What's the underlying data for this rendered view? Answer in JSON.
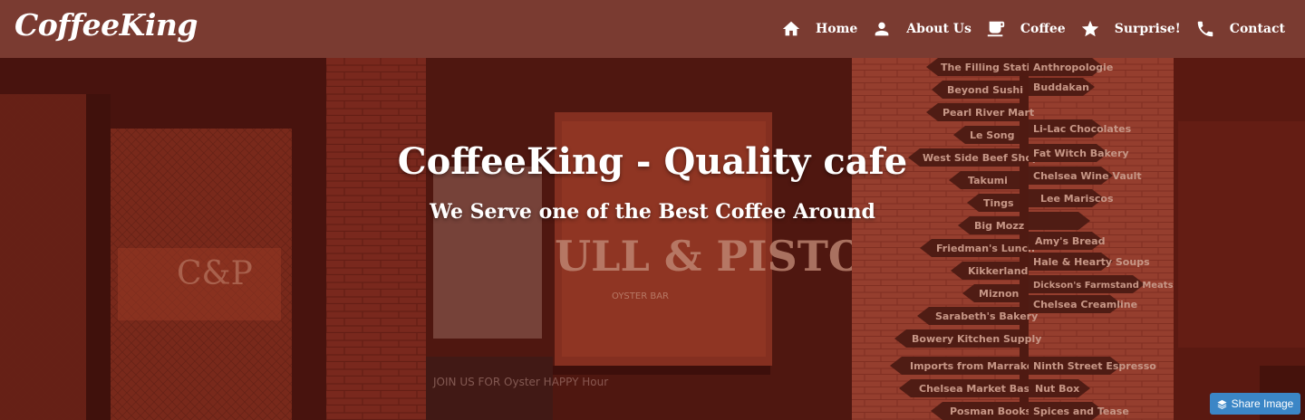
{
  "brand": {
    "logo_text": "CoffeeKing"
  },
  "nav": {
    "items": [
      {
        "icon": "home-icon",
        "label": "Home"
      },
      {
        "icon": "person-icon",
        "label": "About Us"
      },
      {
        "icon": "coffee-cup-icon",
        "label": "Coffee"
      },
      {
        "icon": "star-icon",
        "label": "Surprise!"
      },
      {
        "icon": "phone-icon",
        "label": "Contact"
      }
    ]
  },
  "hero": {
    "title": "CoffeeKing - Quality cafe",
    "subtitle": "We Serve one of the Best Coffee Around",
    "background_image": {
      "signs_left": [
        "The Filling Station",
        "Beyond Sushi",
        "Pearl River Mart",
        "Le Song",
        "West Side Beef Shop",
        "Takumi",
        "Tings",
        "Big Mozz",
        "Friedman's Lunch",
        "Kikkerland",
        "Miznon",
        "Sarabeth's Bakery",
        "Bowery Kitchen Supply",
        "Imports from Marrakesh",
        "Chelsea Market Baskets",
        "Posman Books"
      ],
      "signs_right": [
        "Anthropologie",
        "Buddakan",
        "Li-Lac Chocolates",
        "Fat Witch Bakery",
        "Chelsea Wine Vault",
        "Lee Mariscos",
        "Amy's Bread",
        "Hale & Hearty Soups",
        "Dickson's Farmstand Meats",
        "Chelsea Creamline",
        "Ninth Street Espresso",
        "Nut Box",
        "Spices and Tease"
      ],
      "window_text": "ULL & PISTOL",
      "window_subtext": "OYSTER BAR",
      "door_text": "C&P",
      "chalkboard_text": "JOIN US FOR Oyster HAPPY Hour"
    }
  },
  "share": {
    "label": "Share Image"
  },
  "colors": {
    "topbar": "#7a3b31",
    "share_button": "#3b86c6"
  }
}
